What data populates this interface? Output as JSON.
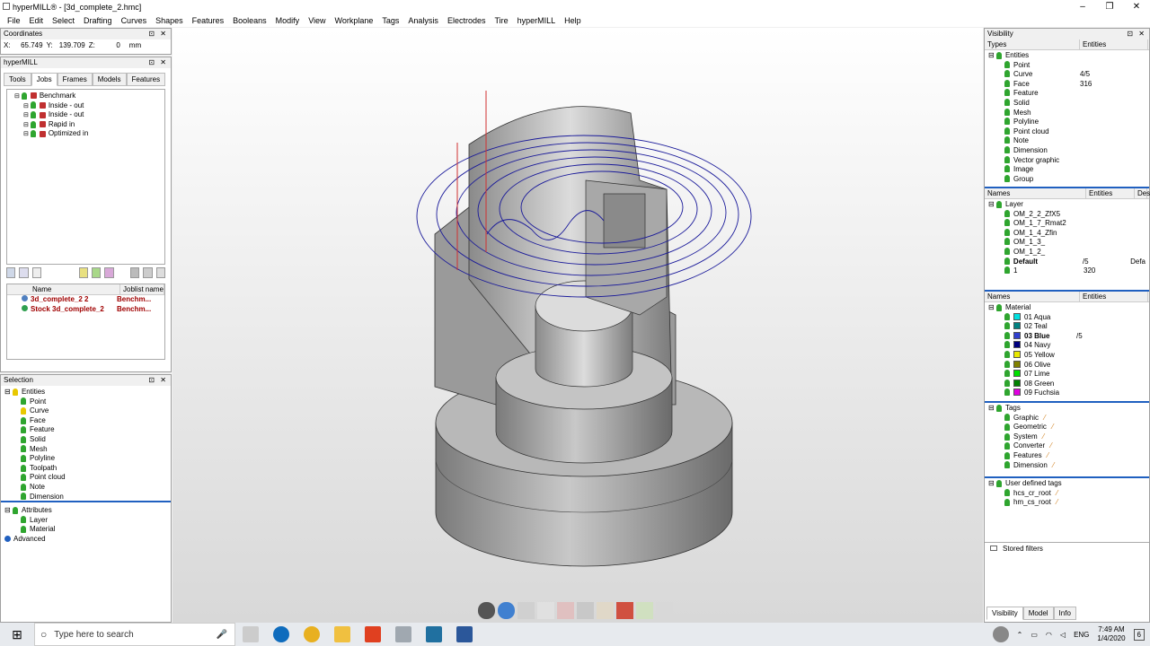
{
  "window": {
    "title": "hyperMILL® - [3d_complete_2.hmc]"
  },
  "menu": [
    "File",
    "Edit",
    "Select",
    "Drafting",
    "Curves",
    "Shapes",
    "Features",
    "Booleans",
    "Modify",
    "View",
    "Workplane",
    "Tags",
    "Analysis",
    "Electrodes",
    "Tire",
    "hyperMILL",
    "Help"
  ],
  "coordinates": {
    "title": "Coordinates",
    "x_label": "X:",
    "x": "65.749",
    "y_label": "Y:",
    "y": "139.709",
    "z_label": "Z:",
    "z": "0",
    "unit": "mm"
  },
  "hypermill": {
    "title": "hyperMILL",
    "tabs": [
      "Tools",
      "Jobs",
      "Frames",
      "Models",
      "Features"
    ],
    "active_tab": "Jobs",
    "jobs": [
      {
        "label": "Benchmark"
      },
      {
        "label": "Inside - out"
      },
      {
        "label": "Inside - out"
      },
      {
        "label": "Rapid in"
      },
      {
        "label": "Optimized in"
      }
    ],
    "list_headers": [
      "Name",
      "Joblist name"
    ],
    "list_rows": [
      {
        "name": "3d_complete_2 2",
        "joblist": "Benchm..."
      },
      {
        "name": "Stock 3d_complete_2",
        "joblist": "Benchm..."
      }
    ]
  },
  "selection": {
    "title": "Selection",
    "root": "Entities",
    "items": [
      "Point",
      "Curve",
      "Face",
      "Feature",
      "Solid",
      "Mesh",
      "Polyline",
      "Toolpath",
      "Point cloud",
      "Note",
      "Dimension"
    ],
    "attributes": {
      "root": "Attributes",
      "items": [
        "Layer",
        "Material"
      ]
    },
    "advanced": "Advanced"
  },
  "visibility": {
    "title": "Visibility",
    "headers": [
      "Types",
      "Entities"
    ],
    "root": "Entities",
    "types": [
      {
        "name": "Point",
        "count": ""
      },
      {
        "name": "Curve",
        "count": "4/5"
      },
      {
        "name": "Face",
        "count": "316"
      },
      {
        "name": "Feature",
        "count": ""
      },
      {
        "name": "Solid",
        "count": ""
      },
      {
        "name": "Mesh",
        "count": ""
      },
      {
        "name": "Polyline",
        "count": ""
      },
      {
        "name": "Point cloud",
        "count": ""
      },
      {
        "name": "Note",
        "count": ""
      },
      {
        "name": "Dimension",
        "count": ""
      },
      {
        "name": "Vector graphic",
        "count": ""
      },
      {
        "name": "Image",
        "count": ""
      },
      {
        "name": "Group",
        "count": ""
      }
    ],
    "layer_headers": [
      "Names",
      "Entities",
      "Des"
    ],
    "layer_root": "Layer",
    "layers": [
      {
        "name": "OM_2_2_ZfX5",
        "count": "",
        "desc": ""
      },
      {
        "name": "OM_1_7_Rmat2",
        "count": "",
        "desc": ""
      },
      {
        "name": "OM_1_4_Zfin",
        "count": "",
        "desc": ""
      },
      {
        "name": "OM_1_3_",
        "count": "",
        "desc": ""
      },
      {
        "name": "OM_1_2_",
        "count": "",
        "desc": ""
      },
      {
        "name": "Default",
        "count": "/5",
        "desc": "Defa"
      },
      {
        "name": "1",
        "count": "320",
        "desc": ""
      }
    ],
    "material_headers": [
      "Names",
      "Entities"
    ],
    "material_root": "Material",
    "materials": [
      {
        "name": "01 Aqua",
        "color": "#00e0e0",
        "count": ""
      },
      {
        "name": "02 Teal",
        "color": "#008080",
        "count": ""
      },
      {
        "name": "03 Blue",
        "color": "#3040d0",
        "count": "/5"
      },
      {
        "name": "04 Navy",
        "color": "#000080",
        "count": ""
      },
      {
        "name": "05 Yellow",
        "color": "#e8e800",
        "count": ""
      },
      {
        "name": "06 Olive",
        "color": "#808000",
        "count": ""
      },
      {
        "name": "07 Lime",
        "color": "#00e000",
        "count": ""
      },
      {
        "name": "08 Green",
        "color": "#008000",
        "count": ""
      },
      {
        "name": "09 Fuchsia",
        "color": "#e000e0",
        "count": ""
      }
    ],
    "tags_root": "Tags",
    "tags": [
      "Graphic",
      "Geometric",
      "System",
      "Converter",
      "Features",
      "Dimension"
    ],
    "user_tags_root": "User defined tags",
    "user_tags": [
      "hcs_cr_root",
      "hm_cs_root"
    ],
    "stored_filters": "Stored filters",
    "bottom_tabs": [
      "Visibility",
      "Model",
      "Info"
    ]
  },
  "taskbar": {
    "search_placeholder": "Type here to search",
    "lang": "ENG",
    "time": "7:49 AM",
    "date": "1/4/2020",
    "notif": "6"
  },
  "colors": {
    "accent": "#2fa52f",
    "toolpath": "#1a1a9a"
  }
}
